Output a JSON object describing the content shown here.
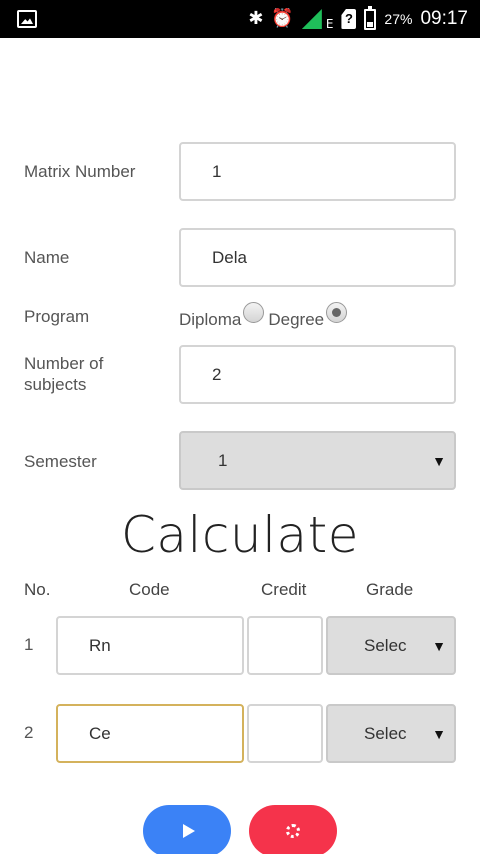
{
  "status_bar": {
    "battery_percent": "27%",
    "time": "09:17",
    "network_type": "E",
    "icons": [
      "gallery-notification-icon",
      "bluetooth-icon",
      "alarm-icon",
      "signal-icon",
      "sim-icon",
      "battery-icon"
    ]
  },
  "form": {
    "matrix_number": {
      "label": "Matrix Number",
      "value": "1"
    },
    "name": {
      "label": "Name",
      "value": "Dela"
    },
    "program": {
      "label": "Program",
      "options": [
        {
          "label": "Diploma",
          "checked": false
        },
        {
          "label": "Degree",
          "checked": true
        }
      ]
    },
    "number_of_subjects": {
      "label_line1": "Number of",
      "label_line2": "subjects",
      "value": "2"
    },
    "semester": {
      "label": "Semester",
      "value": "1"
    }
  },
  "calculate_title": "Calculate",
  "table": {
    "headers": {
      "no": "No.",
      "code": "Code",
      "credit": "Credit",
      "grade": "Grade"
    },
    "rows": [
      {
        "no": "1",
        "code": "Rn",
        "credit": "",
        "grade": "Select"
      },
      {
        "no": "2",
        "code": "Ce",
        "credit": "",
        "grade": "Select"
      }
    ]
  },
  "buttons": {
    "calculate_icon": "play-icon",
    "reset_icon": "spinner-icon"
  },
  "colors": {
    "play_button": "#3b82f6",
    "reset_button": "#f5334b",
    "focused_border": "#d4b25c",
    "signal": "#1fbe5a"
  }
}
